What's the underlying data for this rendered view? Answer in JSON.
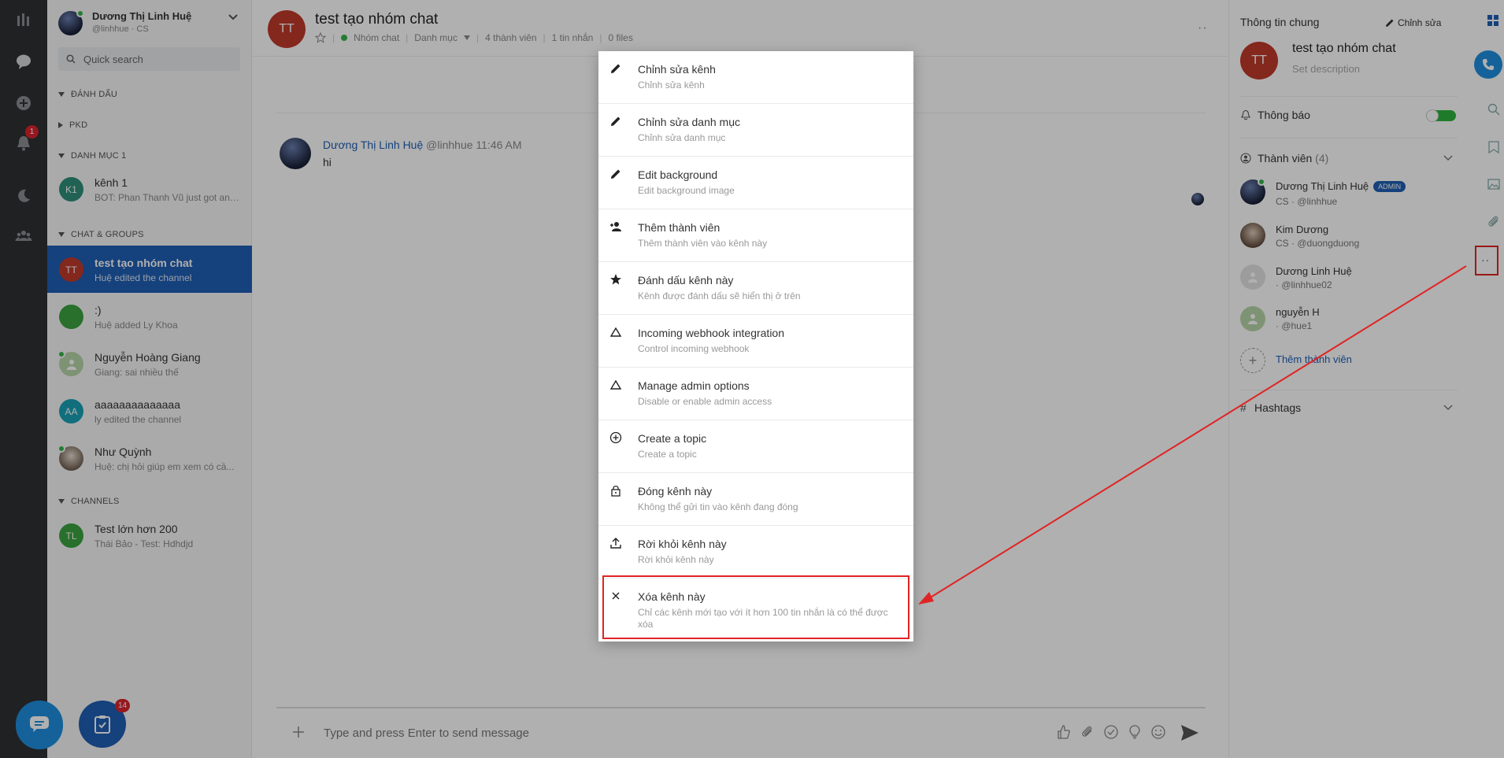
{
  "rail": {
    "notif_badge": "1"
  },
  "user": {
    "name": "Dương Thị Linh Huệ",
    "handle": "@linhhue · CS"
  },
  "search": {
    "placeholder": "Quick search"
  },
  "sections": {
    "starred": "ĐÁNH DẤU",
    "pkd": "PKD",
    "category1": "DANH MỤC 1",
    "chat_groups": "CHAT & GROUPS",
    "channels": "CHANNELS"
  },
  "items": [
    {
      "initials": "K1",
      "name": "kênh 1",
      "sub": "BOT: Phan Thanh Vũ just got an ..."
    },
    {
      "initials": "TT",
      "name": "test tạo nhóm chat",
      "sub": "Huệ edited the channel"
    },
    {
      "initials": "",
      "name": ":)",
      "sub": "Huệ added Ly Khoa"
    },
    {
      "initials": "",
      "name": "Nguyễn Hoàng Giang",
      "sub": "Giang: sai nhiều thế"
    },
    {
      "initials": "AA",
      "name": "aaaaaaaaaaaaaa",
      "sub": "ly edited the channel"
    },
    {
      "initials": "",
      "name": "Như Quỳnh",
      "sub": "Huệ: chị hỏi giúp em xem có cầ..."
    },
    {
      "initials": "TL",
      "name": "Test lớn hơn 200",
      "sub": "Thái Bảo - Test: Hdhdjd"
    }
  ],
  "bottom": {
    "chat_icon": "chat-bubble-icon",
    "task_badge": "14"
  },
  "channel": {
    "initials": "TT",
    "title": "test tạo nhóm chat",
    "type": "Nhóm chat",
    "category": "Danh mục",
    "members": "4 thành viên",
    "messages": "1 tin nhắn",
    "files": "0 files"
  },
  "message": {
    "author": "Dương Thị Linh Huệ",
    "handle": "@linhhue",
    "time": "11:46 AM",
    "text": "hi"
  },
  "composer": {
    "placeholder": "Type and press Enter to send message"
  },
  "menu": [
    {
      "icon": "pencil-icon",
      "label": "Chỉnh sửa kênh",
      "desc": "Chỉnh sửa kênh"
    },
    {
      "icon": "pencil-icon",
      "label": "Chỉnh sửa danh mục",
      "desc": "Chỉnh sửa danh mục"
    },
    {
      "icon": "pencil-icon",
      "label": "Edit background",
      "desc": "Edit background image"
    },
    {
      "icon": "add-person-icon",
      "label": "Thêm thành viên",
      "desc": "Thêm thành viên vào kênh này"
    },
    {
      "icon": "star-icon",
      "label": "Đánh dấu kênh này",
      "desc": "Kênh được đánh dấu sẽ hiển thị ở trên"
    },
    {
      "icon": "triangle-icon",
      "label": "Incoming webhook integration",
      "desc": "Control incoming webhook"
    },
    {
      "icon": "triangle-icon",
      "label": "Manage admin options",
      "desc": "Disable or enable admin access"
    },
    {
      "icon": "plus-circle-icon",
      "label": "Create a topic",
      "desc": "Create a topic"
    },
    {
      "icon": "lock-icon",
      "label": "Đóng kênh này",
      "desc": "Không thể gửi tin vào kênh đang đóng"
    },
    {
      "icon": "upload-icon",
      "label": "Rời khỏi kênh này",
      "desc": "Rời khỏi kênh này"
    },
    {
      "icon": "close-icon",
      "label": "Xóa kênh này",
      "desc": "Chỉ các kênh mới tạo với ít hơn 100 tin nhắn là có thể được xóa"
    }
  ],
  "panel": {
    "title": "Thông tin chung",
    "edit": "Chỉnh sửa",
    "channel_initials": "TT",
    "channel_name": "test tạo nhóm chat",
    "set_desc": "Set description",
    "notify": "Thông báo",
    "members_title": "Thành viên",
    "members_count": "(4)",
    "members": [
      {
        "name": "Dương Thị Linh Huệ",
        "sub": "CS · @linhhue",
        "badge": "ADMIN"
      },
      {
        "name": "Kim Dương",
        "sub": "CS · @duongduong"
      },
      {
        "name": "Dương Linh Huệ",
        "sub": "· @linhhue02"
      },
      {
        "name": "nguyễn H",
        "sub": "· @hue1"
      }
    ],
    "add_member": "Thêm thành viên",
    "hashtags": "Hashtags"
  },
  "colors": {
    "accent": "#1f5fb4",
    "danger": "#e02424",
    "online": "#35b44a",
    "toggle": "#2db23c"
  }
}
